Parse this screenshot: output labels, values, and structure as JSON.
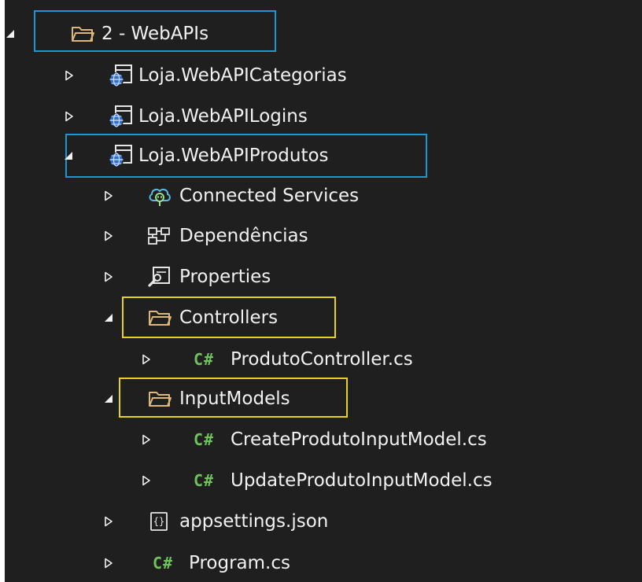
{
  "tree": {
    "folder_webapis": {
      "label": "2 - WebAPIs"
    },
    "project_categorias": {
      "label": "Loja.WebAPICategorias"
    },
    "project_logins": {
      "label": "Loja.WebAPILogins"
    },
    "project_produtos": {
      "label": "Loja.WebAPIProdutos"
    },
    "connected_services": {
      "label": "Connected Services"
    },
    "dependencias": {
      "label": "Dependências"
    },
    "properties": {
      "label": "Properties"
    },
    "folder_controllers": {
      "label": "Controllers"
    },
    "file_produto_controller": {
      "label": "ProdutoController.cs"
    },
    "folder_inputmodels": {
      "label": "InputModels"
    },
    "file_create_input": {
      "label": "CreateProdutoInputModel.cs"
    },
    "file_update_input": {
      "label": "UpdateProdutoInputModel.cs"
    },
    "file_appsettings": {
      "label": "appsettings.json"
    },
    "file_program": {
      "label": "Program.cs"
    }
  },
  "icons": {
    "csharp_glyph": "C#",
    "json_glyph": "{}"
  },
  "colors": {
    "background": "#1f1f1f",
    "text": "#f1f1f1",
    "highlight_blue": "#1c97d4",
    "highlight_yellow": "#e6d21f",
    "csharp_green": "#6ec35a",
    "folder_yellow": "#dcb67a"
  }
}
